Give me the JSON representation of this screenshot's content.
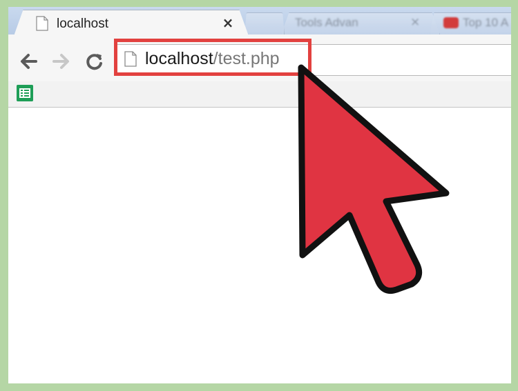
{
  "tabs": {
    "active": {
      "title": "localhost",
      "close_glyph": "×",
      "icon": "document-icon"
    },
    "background": [
      {
        "title": "Tools Advan",
        "close_glyph": "×"
      },
      {
        "title": "Top 10 A",
        "icon": "youtube-icon"
      }
    ]
  },
  "toolbar": {
    "back_icon": "arrow-left-icon",
    "forward_icon": "arrow-right-icon",
    "reload_icon": "reload-icon"
  },
  "omnibox": {
    "host": "localhost",
    "path": "/test.php",
    "icon": "page-icon",
    "highlight_color": "#e2413f"
  },
  "bookmarks": {
    "items": [
      {
        "icon": "sheets-icon",
        "color": "#1e9e57"
      }
    ]
  },
  "overlay": {
    "cursor_color": "#e03442",
    "cursor_outline": "#111111"
  }
}
